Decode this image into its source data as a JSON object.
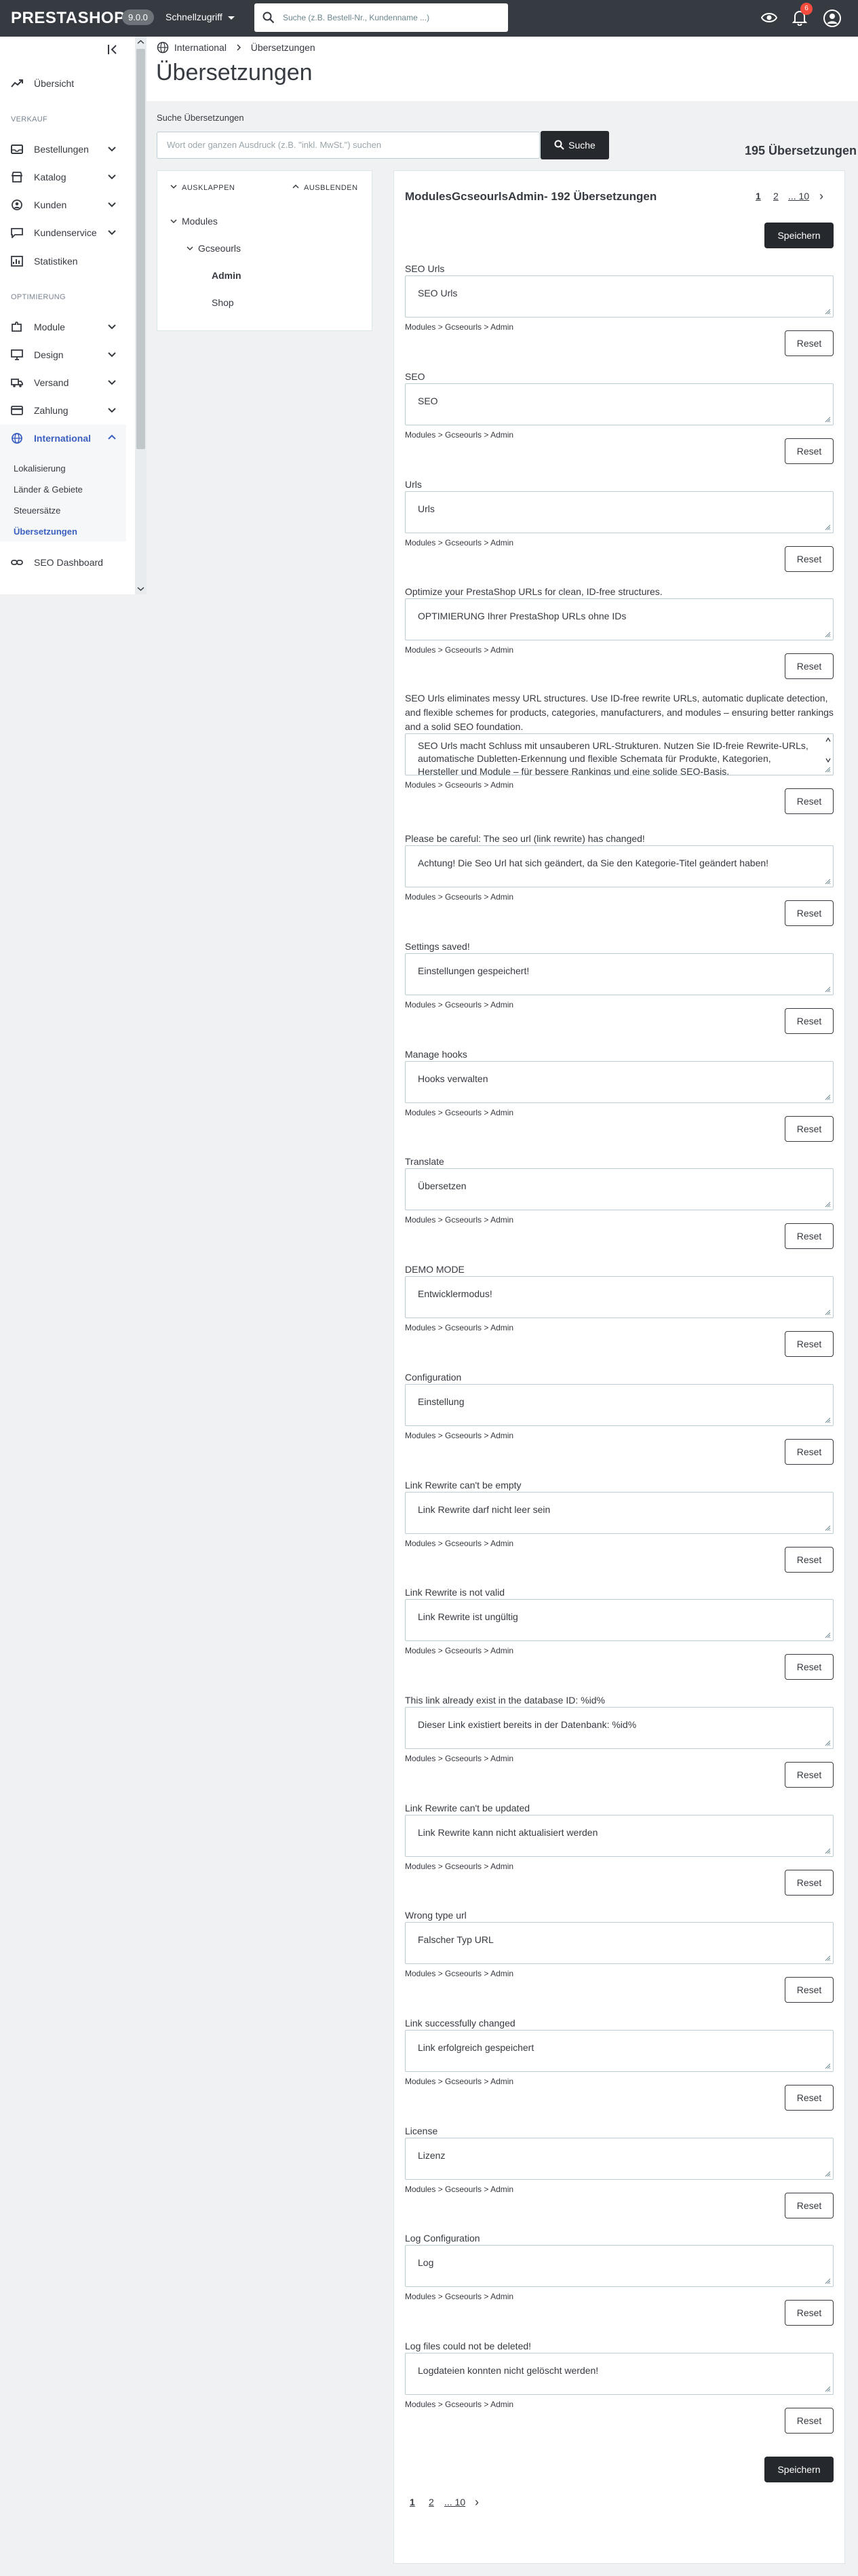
{
  "topbar": {
    "logo": "PRESTASHOP",
    "version": "9.0.0",
    "quick_access": "Schnellzugriff",
    "search_placeholder": "Suche (z.B. Bestell-Nr., Kundenname ...)",
    "notification_count": "6"
  },
  "sidebar": {
    "overview": "Übersicht",
    "section_sales": "VERKAUF",
    "sales_items": [
      "Bestellungen",
      "Katalog",
      "Kunden",
      "Kundenservice",
      "Statistiken"
    ],
    "section_optimize": "OPTIMIERUNG",
    "optimize_items": [
      "Module",
      "Design",
      "Versand",
      "Zahlung",
      "International"
    ],
    "international_sub": [
      "Lokalisierung",
      "Länder & Gebiete",
      "Steuersätze",
      "Übersetzungen"
    ],
    "seo_dashboard": "SEO Dashboard",
    "accent_color": "#3b5fc0"
  },
  "header": {
    "breadcrumb_root": "International",
    "breadcrumb_current": "Übersetzungen",
    "title": "Übersetzungen"
  },
  "search": {
    "label": "Suche Übersetzungen",
    "placeholder": "Wort oder ganzen Ausdruck (z.B. \"inkl. MwSt.\") suchen",
    "button": "Suche",
    "total": "195 Übersetzungen"
  },
  "tree": {
    "expand": "AUSKLAPPEN",
    "collapse": "AUSBLENDEN",
    "root": "Modules",
    "module": "Gcseourls",
    "child_admin": "Admin",
    "child_shop": "Shop"
  },
  "panel": {
    "title": "ModulesGcseourlsAdmin- 192 Übersetzungen",
    "pages": [
      "1",
      "2",
      "... 10"
    ],
    "next": "›",
    "save": "Speichern",
    "path": "Modules > Gcseourls > Admin",
    "reset": "Reset"
  },
  "entries": [
    {
      "source": "SEO Urls",
      "translation": "SEO Urls"
    },
    {
      "source": "SEO",
      "translation": "SEO"
    },
    {
      "source": "Urls",
      "translation": "Urls"
    },
    {
      "source": "Optimize your PrestaShop URLs for clean, ID-free structures.",
      "translation": "OPTIMIERUNG Ihrer PrestaShop URLs ohne IDs"
    },
    {
      "source": "SEO Urls eliminates messy URL structures. Use ID-free rewrite URLs, automatic duplicate detection, and flexible schemes for products, categories, manufacturers, and modules – ensuring better rankings and a solid SEO foundation.",
      "translation": "SEO Urls macht Schluss mit unsauberen URL-Strukturen. Nutzen Sie ID-freie Rewrite-URLs, automatische Dubletten-Erkennung und flexible Schemata für Produkte, Kategorien, Hersteller und Module – für bessere Rankings und eine solide SEO-Basis."
    },
    {
      "source": "Please be careful: The seo url (link rewrite) has changed!",
      "translation": "Achtung! Die Seo Url hat sich geändert, da Sie den Kategorie-Titel geändert haben!"
    },
    {
      "source": "Settings saved!",
      "translation": "Einstellungen gespeichert!"
    },
    {
      "source": "Manage hooks",
      "translation": "Hooks verwalten"
    },
    {
      "source": "Translate",
      "translation": "Übersetzen"
    },
    {
      "source": "DEMO MODE",
      "translation": "Entwicklermodus!"
    },
    {
      "source": "Configuration",
      "translation": "Einstellung"
    },
    {
      "source": "Link Rewrite can't be empty",
      "translation": "Link Rewrite darf nicht leer sein"
    },
    {
      "source": "Link Rewrite is not valid",
      "translation": "Link Rewrite ist ungültig"
    },
    {
      "source": "This link already exist in the database ID: %id%",
      "translation": "Dieser Link existiert bereits in der Datenbank: %id%"
    },
    {
      "source": "Link Rewrite can't be updated",
      "translation": "Link Rewrite kann nicht aktualisiert werden"
    },
    {
      "source": "Wrong type url",
      "translation": "Falscher Typ URL"
    },
    {
      "source": "Link successfully changed",
      "translation": "Link erfolgreich gespeichert"
    },
    {
      "source": "License",
      "translation": "Lizenz"
    },
    {
      "source": "Log Configuration",
      "translation": "Log"
    },
    {
      "source": "Log files could not be deleted!",
      "translation": "Logdateien konnten nicht gelöscht werden!"
    }
  ]
}
